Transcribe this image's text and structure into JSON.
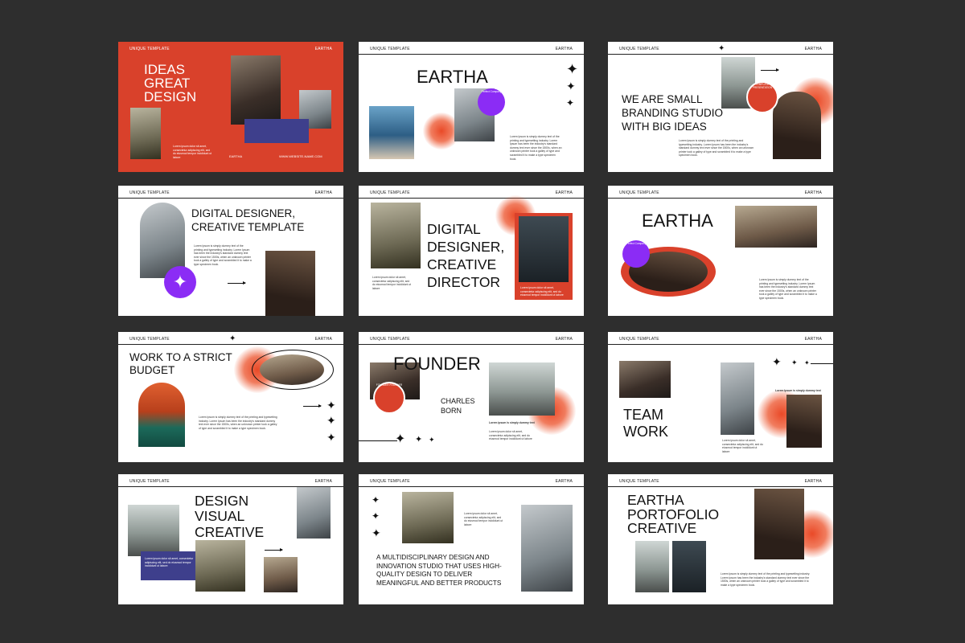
{
  "common": {
    "header_left": "UNIQUE TEMPLATE",
    "header_right": "EARTHA",
    "lorem_short": "Lorem ipsum dolor sit amet, consectetur adipiscing elit, sed do eiusmod tempor incididunt ut labore",
    "lorem_long": "Lorem Ipsum is simply dummy text of the printing and typesetting industry. Lorem Ipsum has been the industry's standard dummy text ever since the 1500s, when an unknown printer took a galley of type and scrambled it to make a type specimen book."
  },
  "slides": {
    "s1": {
      "title": "IDEAS GREAT DESIGN",
      "footer_brand": "EARTHA",
      "footer_web": "WWW.WEBSITE-NAME.COM"
    },
    "s2": {
      "title": "EARTHA",
      "seal": "Perfect Company"
    },
    "s3": {
      "title": "WE ARE SMALL BRANDING STUDIO WITH BIG IDEAS",
      "seal": "TEMPLATE PRESENTATION"
    },
    "s4": {
      "title": "DIGITAL DESIGNER, CREATIVE TEMPLATE"
    },
    "s5": {
      "title": "DIGITAL DESIGNER, CREATIVE DIRECTOR"
    },
    "s6": {
      "title": "EARTHA",
      "seal": "Perfect Company"
    },
    "s7": {
      "title": "WORK TO A STRICT BUDGET"
    },
    "s8": {
      "title": "FOUNDER",
      "name": "CHARLES BORN",
      "caption": "Lorem ipsum is simply dummy text",
      "seal": "FOUNDER FOUNDER"
    },
    "s9": {
      "title": "TEAM WORK",
      "caption": "Lorem Ipsum is simply dummy text"
    },
    "s10": {
      "title": "DESIGN VISUAL CREATIVE"
    },
    "s11": {
      "title": "A MULTIDISCIPLINARY DESIGN AND INNOVATION STUDIO THAT USES HIGH-QUALITY DESIGN TO DELIVER MEANINGFUL AND BETTER PRODUCTS"
    },
    "s12": {
      "title": "EARTHA PORTOFOLIO CREATIVE"
    }
  },
  "colors": {
    "background": "#2e2e2e",
    "accent_red": "#d9412b",
    "purple": "#8b2cf5",
    "navy": "#3e3f8c"
  },
  "icons": [
    "sparkle-star-icon",
    "arrow-right-icon"
  ]
}
